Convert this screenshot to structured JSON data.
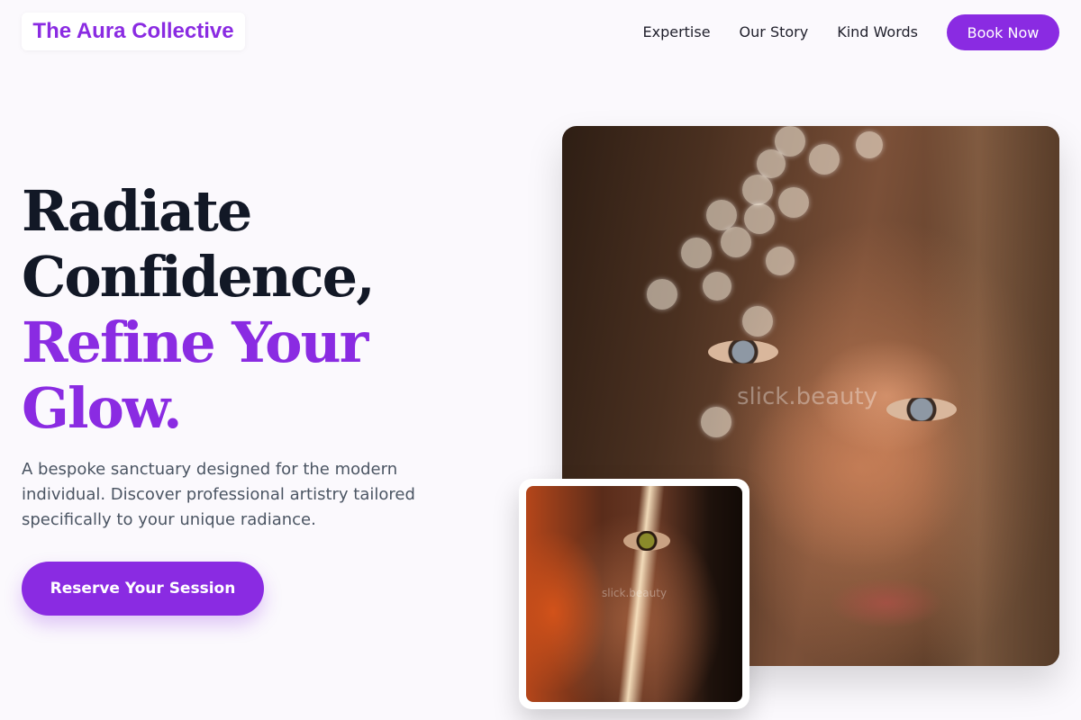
{
  "header": {
    "logo": "The Aura Collective",
    "nav": [
      "Expertise",
      "Our Story",
      "Kind Words"
    ],
    "book_label": "Book Now"
  },
  "hero": {
    "title_line1": "Radiate",
    "title_line2": "Confidence,",
    "title_line3": "Refine Your",
    "title_line4": "Glow.",
    "description": "A bespoke sanctuary designed for the modern individual. Discover professional artistry tailored specifically to your unique radiance.",
    "cta_label": "Reserve Your Session"
  },
  "images": {
    "main_watermark": "slick.beauty",
    "small_watermark": "slick.beauty"
  },
  "colors": {
    "accent": "#8a2be2",
    "heading": "#121826",
    "body_text": "#4b5563",
    "background": "#fbf9fd"
  }
}
